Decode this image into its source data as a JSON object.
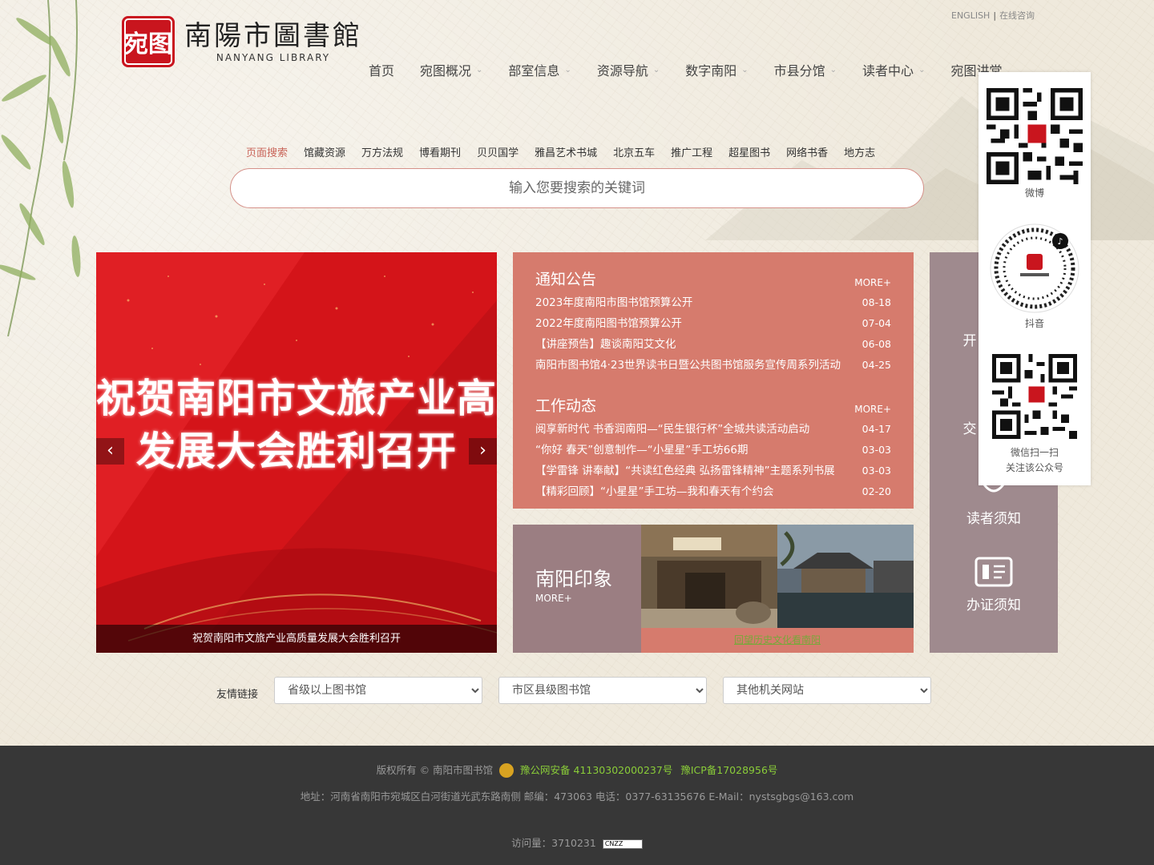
{
  "header": {
    "logo_seal": "宛图",
    "logo_cn": "南陽市圖書館",
    "logo_en": "NANYANG LIBRARY",
    "toplinks": [
      "ENGLISH",
      "在线咨询"
    ],
    "nav": [
      "首页",
      "宛图概况",
      "部室信息",
      "资源导航",
      "数字南阳",
      "市县分馆",
      "读者中心",
      "宛图讲堂"
    ]
  },
  "search": {
    "tabs": [
      "页面搜索",
      "馆藏资源",
      "万方法规",
      "博看期刊",
      "贝贝国学",
      "雅昌艺术书城",
      "北京五车",
      "推广工程",
      "超星图书",
      "网络书香",
      "地方志"
    ],
    "placeholder": "输入您要搜索的关键词"
  },
  "banner": {
    "title_line1": "祝贺南阳市文旅产业高质量",
    "title_line2": "发展大会胜利召开",
    "caption": "祝贺南阳市文旅产业高质量发展大会胜利召开"
  },
  "notices": {
    "title": "通知公告",
    "more": "MORE+",
    "items": [
      {
        "t": "2023年度南阳市图书馆预算公开",
        "d": "08-18"
      },
      {
        "t": "2022年度南阳图书馆预算公开",
        "d": "07-04"
      },
      {
        "t": "【讲座预告】趣谈南阳艾文化",
        "d": "06-08"
      },
      {
        "t": "南阳市图书馆4·23世界读书日暨公共图书馆服务宣传周系列活动",
        "d": "04-25"
      }
    ]
  },
  "dynamics": {
    "title": "工作动态",
    "more": "MORE+",
    "items": [
      {
        "t": "阅享新时代 书香润南阳—“民生银行杯”全城共读活动启动",
        "d": "04-17"
      },
      {
        "t": "“你好 春天”创意制作—“小星星”手工坊66期",
        "d": "03-03"
      },
      {
        "t": "【学雷锋 讲奉献】“共读红色经典 弘扬雷锋精神”主题系列书展",
        "d": "03-03"
      },
      {
        "t": "【精彩回顾】“小星星”手工坊—我和春天有个约会",
        "d": "02-20"
      }
    ]
  },
  "impression": {
    "title": "南阳印象",
    "more": "MORE+",
    "caption": "回望历史文化看南阳"
  },
  "services": [
    "开",
    "交",
    "读者须知",
    "办证须知"
  ],
  "qr": {
    "weibo": "微博",
    "douyin": "抖音",
    "wechat_line1": "微信扫一扫",
    "wechat_line2": "关注该公众号"
  },
  "friends": {
    "label": "友情链接",
    "selects": [
      "省级以上图书馆",
      "市区县级图书馆",
      "其他机关网站"
    ]
  },
  "footer": {
    "copyright": "版权所有 © 南阳市图书馆",
    "police": "豫公网安备 41130302000237号",
    "icp": "豫ICP备17028956号",
    "address": "地址：河南省南阳市宛城区白河街道光武东路南侧  邮编：473063 电话：0377-63135676 E-Mail：nystsgbgs@163.com",
    "visits_label": "访问量：3710231",
    "cnzz": "CNZZ"
  },
  "colors": {
    "accent": "#d67b6d",
    "service_panel": "#9f8a8e",
    "banner_red": "#d7161c",
    "footer_bg": "#373737"
  }
}
